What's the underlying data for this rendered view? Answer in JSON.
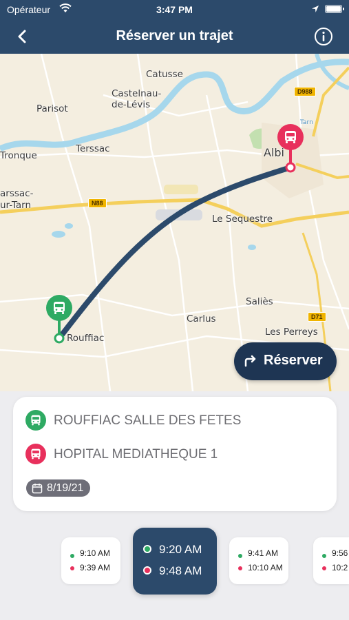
{
  "status_bar": {
    "carrier": "Opérateur",
    "time": "3:47 PM"
  },
  "nav": {
    "title": "Réserver un trajet",
    "back_icon": "chevron-left-icon",
    "info_icon": "info-circle-icon"
  },
  "map": {
    "places": {
      "catusse": "Catusse",
      "castelnau_1": "Castelnau-",
      "castelnau_2": "de-Lévis",
      "parisot": "Parisot",
      "terssac": "Terssac",
      "tronque": "Tronque",
      "marssac_1": "arssac-",
      "marssac_2": "ur-Tarn",
      "albi": "Albi",
      "le_sequestre": "Le Sequestre",
      "saliès": "Saliès",
      "carlus": "Carlus",
      "rouffiac": "Rouffiac",
      "les_perreys": "Les Perreys",
      "tarn": "Tarn"
    },
    "roads": {
      "d988": "D988",
      "n88": "N88",
      "d71": "D71"
    },
    "colors": {
      "route": "#2c4a6b",
      "origin": "#2eaa63",
      "destination": "#e8305c"
    }
  },
  "reserve_button": {
    "label": "Réserver"
  },
  "trip": {
    "origin": "ROUFFIAC SALLE DES FETES",
    "destination": "HOPITAL MEDIATHEQUE 1",
    "date": "8/19/21"
  },
  "slots": [
    {
      "depart": "9:10 AM",
      "arrive": "9:39 AM",
      "selected": false
    },
    {
      "depart": "9:20 AM",
      "arrive": "9:48 AM",
      "selected": true
    },
    {
      "depart": "9:41 AM",
      "arrive": "10:10 AM",
      "selected": false
    },
    {
      "depart": "9:56",
      "arrive": "10:2",
      "selected": false
    }
  ]
}
